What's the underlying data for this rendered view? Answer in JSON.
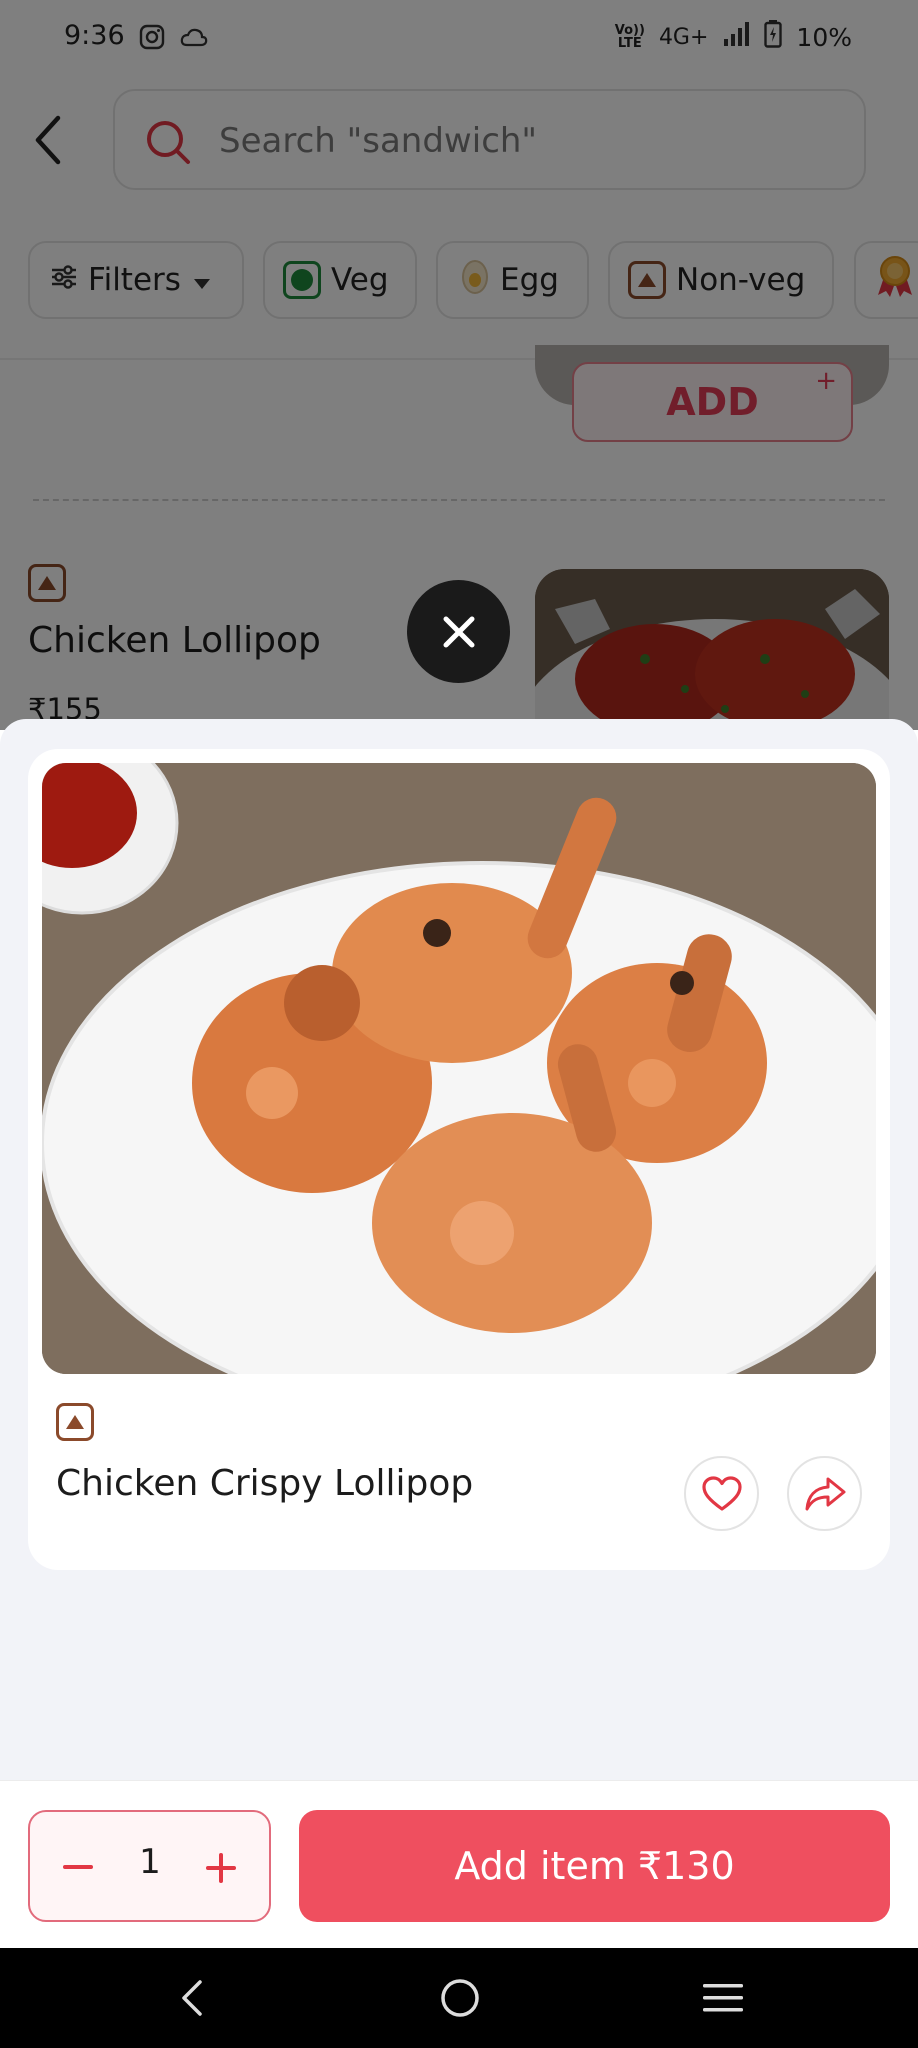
{
  "status_bar": {
    "time": "9:36",
    "network_top": "Vo))",
    "network_bottom": "LTE",
    "signal": "4G+",
    "battery": "10%"
  },
  "search": {
    "placeholder": "Search \"sandwich\""
  },
  "filters": {
    "filters_label": "Filters",
    "veg_label": "Veg",
    "egg_label": "Egg",
    "nonveg_label": "Non-veg"
  },
  "background_list": {
    "add_label": "ADD",
    "add_plus": "+",
    "item_name": "Chicken Lollipop",
    "item_price": "₹155"
  },
  "sheet": {
    "item_title": "Chicken Crispy Lollipop",
    "quantity": "1",
    "add_item_label": "Add item ₹130"
  },
  "icons": {
    "search": "search-icon",
    "filter": "sliders-icon",
    "close": "close-icon",
    "heart": "heart-icon",
    "share": "share-icon"
  },
  "colors": {
    "accent": "#ef4f5f",
    "accent_text": "#e23d57",
    "veg": "#1f8a3c",
    "nonveg": "#8b4a2b"
  }
}
